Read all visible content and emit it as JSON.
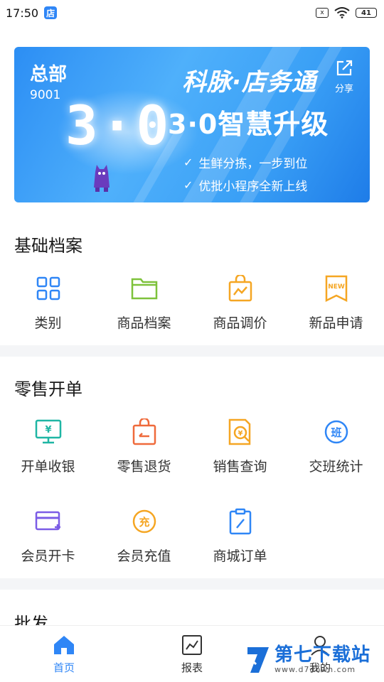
{
  "status_bar": {
    "time": "17:50",
    "app_icon_char": "店",
    "sim_icon": "x",
    "battery": "41"
  },
  "banner": {
    "store_name": "总部",
    "store_code": "9001",
    "big_version": "3·0",
    "brand": "科脉·店务通",
    "upgrade": "3·0智慧升级",
    "features": [
      "生鲜分拣，一步到位",
      "优批小程序全新上线"
    ],
    "share_label": "分享",
    "colors": {
      "from": "#2c8ef4",
      "to": "#1e7ce8"
    }
  },
  "sections": [
    {
      "title": "基础档案",
      "items": [
        {
          "label": "类别",
          "icon": "category-grid-icon",
          "color": "#2f86f6"
        },
        {
          "label": "商品档案",
          "icon": "folder-icon",
          "color": "#7ec23b"
        },
        {
          "label": "商品调价",
          "icon": "price-bag-icon",
          "color": "#f5a623"
        },
        {
          "label": "新品申请",
          "icon": "new-badge-icon",
          "color": "#f5a623"
        }
      ]
    },
    {
      "title": "零售开单",
      "items": [
        {
          "label": "开单收银",
          "icon": "cashier-monitor-icon",
          "color": "#1fb6a4"
        },
        {
          "label": "零售退货",
          "icon": "return-bag-icon",
          "color": "#ef6a3b"
        },
        {
          "label": "销售查询",
          "icon": "sales-search-icon",
          "color": "#f5a623"
        },
        {
          "label": "交班统计",
          "icon": "shift-stats-icon",
          "color": "#2f86f6"
        },
        {
          "label": "会员开卡",
          "icon": "member-card-icon",
          "color": "#7b5ce6"
        },
        {
          "label": "会员充值",
          "icon": "recharge-icon",
          "color": "#f5a623"
        },
        {
          "label": "商城订单",
          "icon": "mall-order-icon",
          "color": "#2f86f6"
        }
      ]
    },
    {
      "title": "批发"
    }
  ],
  "icon_chars": {
    "shift": "班",
    "recharge": "充",
    "yen": "¥",
    "new": "NEW"
  },
  "bottom_nav": [
    {
      "label": "首页",
      "icon": "home-icon",
      "active": true
    },
    {
      "label": "报表",
      "icon": "report-chart-icon",
      "active": false
    },
    {
      "label": "我的",
      "icon": "profile-icon",
      "active": false
    }
  ],
  "watermark": {
    "title": "第七下载站",
    "url": "www.d7down.com"
  },
  "accent": "#2f86f6"
}
